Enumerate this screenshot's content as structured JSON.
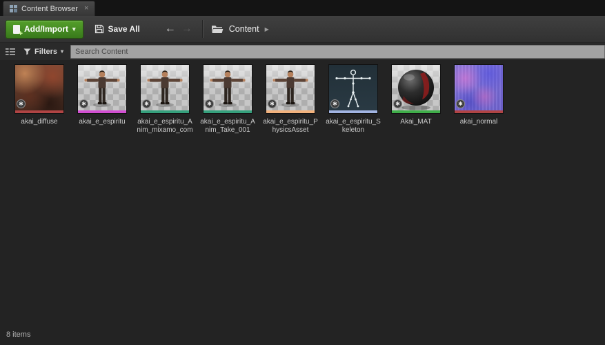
{
  "tab": {
    "title": "Content Browser",
    "close_glyph": "×"
  },
  "toolbar": {
    "add_import_label": "Add/Import",
    "add_caret_glyph": "▾",
    "save_all_label": "Save All",
    "back_glyph": "←",
    "forward_glyph": "→",
    "breadcrumb_root": "Content",
    "breadcrumb_arrow_glyph": "▶"
  },
  "filter_bar": {
    "filters_label": "Filters",
    "filters_caret_glyph": "▾",
    "search_placeholder": "Search Content"
  },
  "badges": {
    "unsaved_glyph": "✱"
  },
  "colors": {
    "accent_green": "#4a9627",
    "search_field_bg": "#a3a3a3",
    "panel_bg": "#232323",
    "toolbar_bg": "#383838"
  },
  "status_bar": {
    "item_count": "8 items"
  },
  "assets": [
    {
      "name": "akai_diffuse",
      "thumbnail": "texture-photo",
      "type_color": "#b04444"
    },
    {
      "name": "akai_e_espiritu",
      "thumbnail": "character-tpose",
      "type_color": "#d24fd2"
    },
    {
      "name": "akai_e_espiritu_Anim_mixamo_com",
      "thumbnail": "character-tpose",
      "type_color": "#35a07c"
    },
    {
      "name": "akai_e_espiritu_Anim_Take_001",
      "thumbnail": "character-tpose",
      "type_color": "#35a07c"
    },
    {
      "name": "akai_e_espiritu_PhysicsAsset",
      "thumbnail": "character-tpose",
      "type_color": "#f2b27d"
    },
    {
      "name": "akai_e_espiritu_Skeleton",
      "thumbnail": "skeleton",
      "type_color": "#a2b4e2"
    },
    {
      "name": "Akai_MAT",
      "thumbnail": "material-sphere",
      "type_color": "#3fae49"
    },
    {
      "name": "akai_normal",
      "thumbnail": "normal-map",
      "type_color": "#b04444"
    }
  ]
}
